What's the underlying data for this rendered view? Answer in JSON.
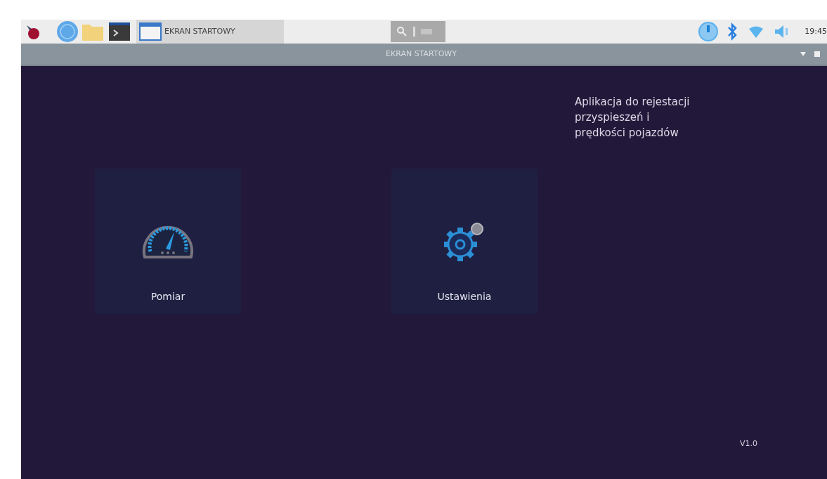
{
  "taskbar": {
    "task_button": "EKRAN STARTOWY",
    "clock": "19:45"
  },
  "window": {
    "title": "EKRAN STARTOWY"
  },
  "tiles": [
    {
      "label": "Pomiar",
      "kind": "gauge"
    },
    {
      "label": "Ustawienia",
      "kind": "gear"
    }
  ],
  "description": "Aplikacja do rejestacji przyspieszeń i prędkości pojazdów",
  "version": "V1.0"
}
